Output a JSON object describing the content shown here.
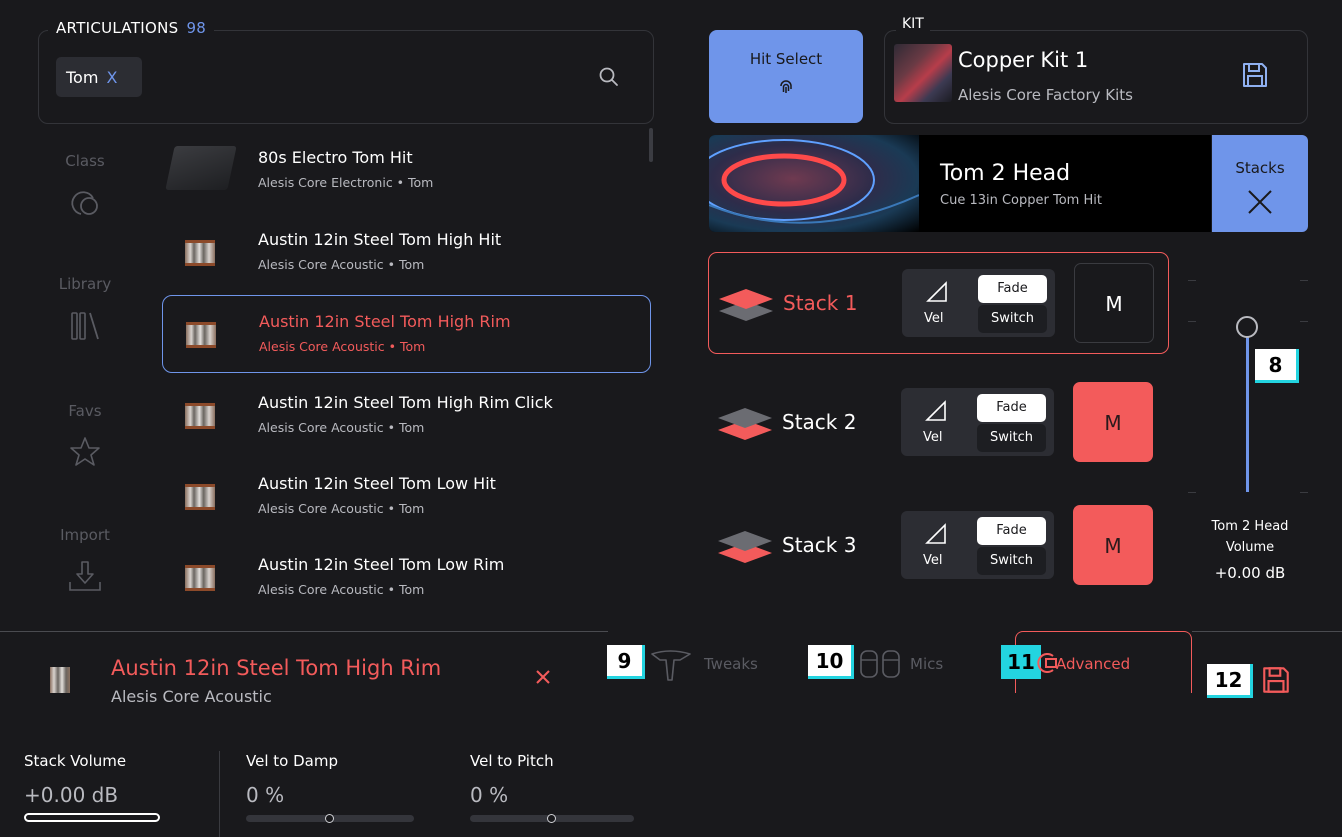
{
  "colors": {
    "background": "#19191c",
    "accent_blue": "#6f95ea",
    "accent_red": "#f35b5b",
    "callout_cyan": "#23d4e0"
  },
  "articulations": {
    "title": "ARTICULATIONS",
    "count": "98",
    "search_tag": "Tom",
    "search_tag_clear": "X",
    "search_icon": "search-icon"
  },
  "sidebar": {
    "items": [
      {
        "label": "Class",
        "icon": "class-icon"
      },
      {
        "label": "Library",
        "icon": "library-icon"
      },
      {
        "label": "Favs",
        "icon": "star-icon"
      },
      {
        "label": "Import",
        "icon": "import-icon"
      }
    ]
  },
  "list": {
    "items": [
      {
        "title": "80s Electro Tom Hit",
        "meta": "Alesis Core Electronic • Tom"
      },
      {
        "title": "Austin 12in Steel Tom High Hit",
        "meta": "Alesis Core Acoustic • Tom"
      },
      {
        "title": "Austin 12in Steel Tom High Rim",
        "meta": "Alesis Core Acoustic • Tom",
        "selected": true
      },
      {
        "title": "Austin 12in Steel Tom High Rim Click",
        "meta": "Alesis Core Acoustic • Tom"
      },
      {
        "title": "Austin 12in Steel Tom Low Hit",
        "meta": "Alesis Core Acoustic • Tom"
      },
      {
        "title": "Austin 12in Steel Tom Low Rim",
        "meta": "Alesis Core Acoustic • Tom"
      }
    ]
  },
  "hit_select": {
    "label": "Hit Select",
    "icon": "fingerprint-icon"
  },
  "kit": {
    "title": "KIT",
    "name": "Copper Kit 1",
    "library": "Alesis Core Factory Kits",
    "save_icon": "save-icon"
  },
  "head": {
    "name": "Tom 2 Head",
    "sub": "Cue 13in Copper Tom Hit",
    "stacks_label": "Stacks",
    "stacks_close": "close-icon"
  },
  "stacks": [
    {
      "label": "Stack 1",
      "vel": "Vel",
      "fade": "Fade",
      "switch": "Switch",
      "mute": "M",
      "muted": false,
      "active": true
    },
    {
      "label": "Stack 2",
      "vel": "Vel",
      "fade": "Fade",
      "switch": "Switch",
      "mute": "M",
      "muted": true,
      "active": false
    },
    {
      "label": "Stack 3",
      "vel": "Vel",
      "fade": "Fade",
      "switch": "Switch",
      "mute": "M",
      "muted": true,
      "active": false
    }
  ],
  "volume": {
    "label_line1": "Tom 2 Head",
    "label_line2": "Volume",
    "value": "+0.00 dB",
    "level": 1.0
  },
  "callouts": {
    "c8": "8",
    "c9": "9",
    "c10": "10",
    "c11": "11",
    "c12": "12"
  },
  "selected": {
    "name": "Austin 12in Steel Tom High Rim",
    "library": "Alesis Core Acoustic",
    "close": "×"
  },
  "tabs": {
    "tweaks": "Tweaks",
    "mics": "Mics",
    "advanced": "Advanced"
  },
  "params": {
    "stack_volume": {
      "label": "Stack Volume",
      "value": "+0.00 dB",
      "fraction": 1.0
    },
    "vel_to_damp": {
      "label": "Vel to Damp",
      "value": "0 %",
      "fraction": 0.5
    },
    "vel_to_pitch": {
      "label": "Vel to Pitch",
      "value": "0 %",
      "fraction": 0.5
    }
  }
}
